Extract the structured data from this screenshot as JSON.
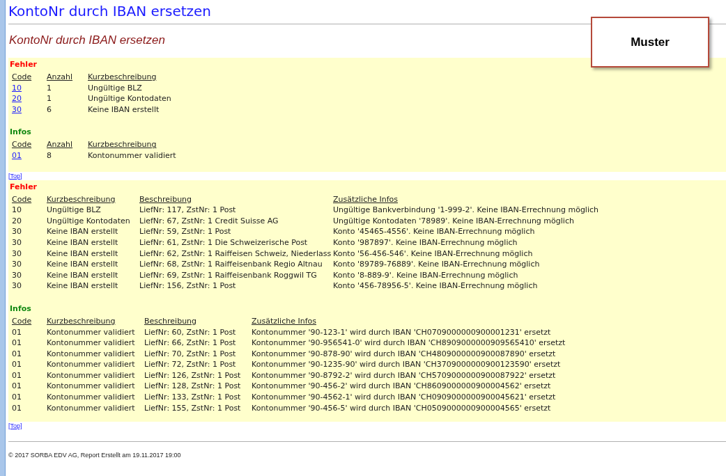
{
  "title": "KontoNr durch IBAN ersetzen",
  "report_title": "KontoNr durch IBAN ersetzen",
  "stamp": "Muster",
  "panels": [
    {
      "top_link": "[Top]",
      "sections": [
        {
          "heading": "Fehler",
          "kind": "error",
          "columns": [
            "Code",
            "Anzahl",
            "Kurzbeschreibung"
          ],
          "rows": [
            {
              "cells": [
                "10",
                "1",
                "Ungültige BLZ"
              ]
            },
            {
              "cells": [
                "20",
                "1",
                "Ungültige Kontodaten"
              ]
            },
            {
              "cells": [
                "30",
                "6",
                "Keine IBAN erstellt"
              ]
            }
          ]
        },
        {
          "heading": "Infos",
          "kind": "info",
          "columns": [
            "Code",
            "Anzahl",
            "Kurzbeschreibung"
          ],
          "rows": [
            {
              "cells": [
                "01",
                "8",
                "Kontonummer validiert"
              ]
            }
          ]
        }
      ]
    },
    {
      "top_link": "[Top]",
      "sections": [
        {
          "heading": "Fehler",
          "kind": "error",
          "columns": [
            "Code",
            "Kurzbeschreibung",
            "Beschreibung",
            "Zusätzliche Infos"
          ],
          "rows": [
            {
              "cells": [
                "10",
                "Ungültige BLZ",
                "LiefNr: 117, ZstNr: 1 Post",
                "Ungültige Bankverbindung '1-999-2'. Keine IBAN-Errechnung möglich"
              ]
            },
            {
              "cells": [
                "20",
                "Ungültige Kontodaten",
                "LiefNr: 67, ZstNr: 1 Credit Suisse AG",
                "Ungültige Kontodaten '78989'. Keine IBAN-Errechnung möglich"
              ]
            },
            {
              "cells": [
                "30",
                "Keine IBAN erstellt",
                "LiefNr: 59, ZstNr: 1 Post",
                "Konto '45465-4556'. Keine IBAN-Errechnung möglich"
              ]
            },
            {
              "cells": [
                "30",
                "Keine IBAN erstellt",
                "LiefNr: 61, ZstNr: 1 Die Schweizerische Post",
                "Konto '987897'. Keine IBAN-Errechnung möglich"
              ]
            },
            {
              "cells": [
                "30",
                "Keine IBAN erstellt",
                "LiefNr: 62, ZstNr: 1 Raiffeisen Schweiz, Niederlass",
                "Konto '56-456-546'. Keine IBAN-Errechnung möglich"
              ]
            },
            {
              "cells": [
                "30",
                "Keine IBAN erstellt",
                "LiefNr: 68, ZstNr: 1 Raiffeisenbank Regio Altnau",
                "Konto '89789-76889'. Keine IBAN-Errechnung möglich"
              ]
            },
            {
              "cells": [
                "30",
                "Keine IBAN erstellt",
                "LiefNr: 69, ZstNr: 1 Raiffeisenbank Roggwil TG",
                "Konto '8-889-9'. Keine IBAN-Errechnung möglich"
              ]
            },
            {
              "cells": [
                "30",
                "Keine IBAN erstellt",
                "LiefNr: 156, ZstNr: 1 Post",
                "Konto '456-78956-5'. Keine IBAN-Errechnung möglich"
              ]
            }
          ]
        },
        {
          "heading": "Infos",
          "kind": "info",
          "columns": [
            "Code",
            "Kurzbeschreibung",
            "Beschreibung",
            "Zusätzliche Infos"
          ],
          "rows": [
            {
              "cells": [
                "01",
                "Kontonummer validiert",
                "LiefNr: 60, ZstNr: 1 Post",
                "Kontonummer '90-123-1' wird durch IBAN 'CH0709000000900001231' ersetzt"
              ]
            },
            {
              "cells": [
                "01",
                "Kontonummer validiert",
                "LiefNr: 66, ZstNr: 1 Post",
                "Kontonummer '90-956541-0' wird durch IBAN 'CH8909000000909565410' ersetzt"
              ]
            },
            {
              "cells": [
                "01",
                "Kontonummer validiert",
                "LiefNr: 70, ZstNr: 1 Post",
                "Kontonummer '90-878-90' wird durch IBAN 'CH4809000000900087890' ersetzt"
              ]
            },
            {
              "cells": [
                "01",
                "Kontonummer validiert",
                "LiefNr: 72, ZstNr: 1 Post",
                "Kontonummer '90-1235-90' wird durch IBAN 'CH3709000000900123590' ersetzt"
              ]
            },
            {
              "cells": [
                "01",
                "Kontonummer validiert",
                "LiefNr: 126, ZstNr: 1 Post",
                "Kontonummer '90-8792-2' wird durch IBAN 'CH5709000000900087922' ersetzt"
              ]
            },
            {
              "cells": [
                "01",
                "Kontonummer validiert",
                "LiefNr: 128, ZstNr: 1 Post",
                "Kontonummer '90-456-2' wird durch IBAN 'CH8609000000900004562' ersetzt"
              ]
            },
            {
              "cells": [
                "01",
                "Kontonummer validiert",
                "LiefNr: 133, ZstNr: 1 Post",
                "Kontonummer '90-4562-1' wird durch IBAN 'CH0909000000900045621' ersetzt"
              ]
            },
            {
              "cells": [
                "01",
                "Kontonummer validiert",
                "LiefNr: 155, ZstNr: 1 Post",
                "Kontonummer '90-456-5' wird durch IBAN 'CH0509000000900004565' ersetzt"
              ]
            }
          ]
        }
      ]
    }
  ],
  "footer": "© 2017 SORBA EDV AG, Report Erstellt am 19.11.2017 19:00"
}
